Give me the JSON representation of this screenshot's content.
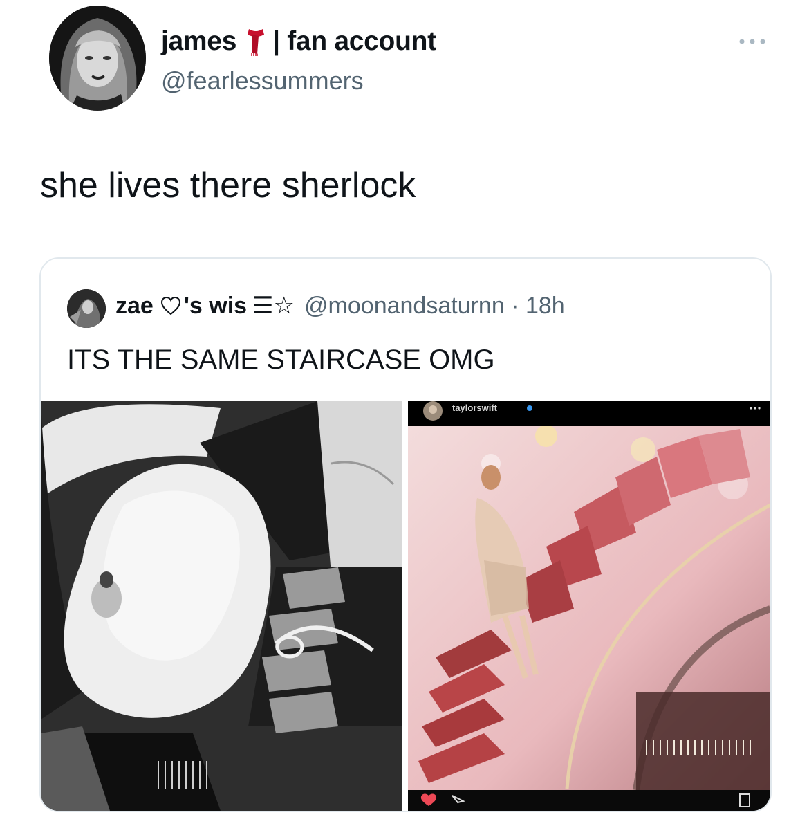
{
  "author": {
    "display_name_prefix": "james",
    "display_name_suffix": "| fan account",
    "handle": "@fearlessummers",
    "avatar_icon": "profile-photo-avatar",
    "badge_icon": "scarf-icon"
  },
  "tweet": {
    "text": "she lives there sherlock"
  },
  "quoted_tweet": {
    "name": "zae",
    "name_rest": "'s wis",
    "name_symbols": "☰☆",
    "handle_time": "@moonandsaturnn · 18h",
    "text": "ITS THE SAME STAIRCASE OMG",
    "images": {
      "left": "black-and-white-staircase-photo",
      "right": {
        "description_icon": "instagram-screenshot",
        "username": "taylorswift"
      }
    }
  },
  "colors": {
    "text_primary": "#0f1419",
    "text_secondary": "#536471",
    "card_border": "#e1e8ed",
    "scarf_red": "#c8102e",
    "ig_heart": "#ed4956"
  }
}
